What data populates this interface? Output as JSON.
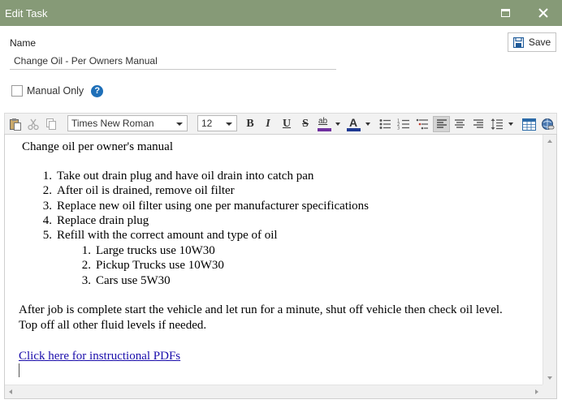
{
  "window": {
    "title": "Edit Task"
  },
  "form": {
    "name_label": "Name",
    "name_value": "Change Oil - Per Owners Manual",
    "save_label": "Save",
    "manual_only_label": "Manual Only",
    "manual_only_checked": false,
    "help_glyph": "?"
  },
  "toolbar": {
    "font_family": "Times New Roman",
    "font_size": "12",
    "bold": "B",
    "italic": "I",
    "underline": "U",
    "strikethrough": "S",
    "highlight_glyph": "ab",
    "font_color_glyph": "A",
    "highlight_color": "#7030a0",
    "font_color": "#1f3a93",
    "icons": [
      "paste-icon",
      "cut-icon",
      "copy-icon",
      "bullet-list-icon",
      "numbered-list-icon",
      "multilevel-list-icon",
      "align-left-icon",
      "align-center-icon",
      "align-right-icon",
      "line-spacing-icon",
      "table-icon",
      "hyperlink-icon"
    ]
  },
  "document": {
    "heading": "Change oil per owner's manual",
    "steps": [
      {
        "num": "1.",
        "text": "Take out drain plug and have oil drain into catch pan"
      },
      {
        "num": "2.",
        "text": "After oil is drained, remove oil filter"
      },
      {
        "num": "3.",
        "text": "Replace new oil filter using one per manufacturer specifications"
      },
      {
        "num": "4.",
        "text": "Replace drain plug"
      },
      {
        "num": "5.",
        "text": "Refill with the correct amount and type of oil"
      }
    ],
    "substeps": [
      {
        "num": "1.",
        "text": "Large trucks use 10W30"
      },
      {
        "num": "2.",
        "text": "Pickup Trucks use 10W30"
      },
      {
        "num": "3.",
        "text": "Cars use 5W30"
      }
    ],
    "closing_line1": "After job is complete start the vehicle and let run for a minute, shut off vehicle then check oil level.",
    "closing_line2": "Top off all other fluid levels if needed.",
    "link_text": "Click here for instructional PDFs"
  },
  "colors": {
    "titlebar": "#869a77",
    "help_icon": "#1e6fb8",
    "link": "#1a0dab"
  }
}
